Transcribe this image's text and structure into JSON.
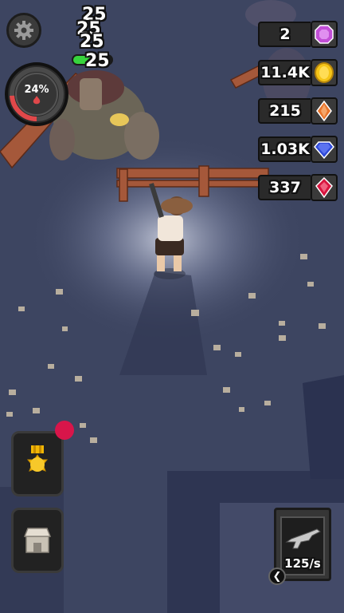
{
  "damage_numbers": [
    "25",
    "25",
    "25",
    "25"
  ],
  "gauge": {
    "percent_label": "24%",
    "fill_fraction": 0.24
  },
  "enemy_health": {
    "fraction": 0.6
  },
  "resources": [
    {
      "value": "2",
      "icon": "purple-gem-icon",
      "color": "#c24fd6"
    },
    {
      "value": "11.4K",
      "icon": "gold-coin-icon",
      "color": "#f5c518"
    },
    {
      "value": "215",
      "icon": "orange-crystal-icon",
      "color": "#e8742c"
    },
    {
      "value": "1.03K",
      "icon": "blue-diamond-icon",
      "color": "#2f4ad8"
    },
    {
      "value": "337",
      "icon": "red-ruby-icon",
      "color": "#d8153f"
    }
  ],
  "weapon": {
    "rate_label": "125/s",
    "icon": "assault-rifle-icon"
  },
  "side_buttons": [
    {
      "icon": "medal-icon"
    },
    {
      "icon": "shop-icon"
    }
  ]
}
